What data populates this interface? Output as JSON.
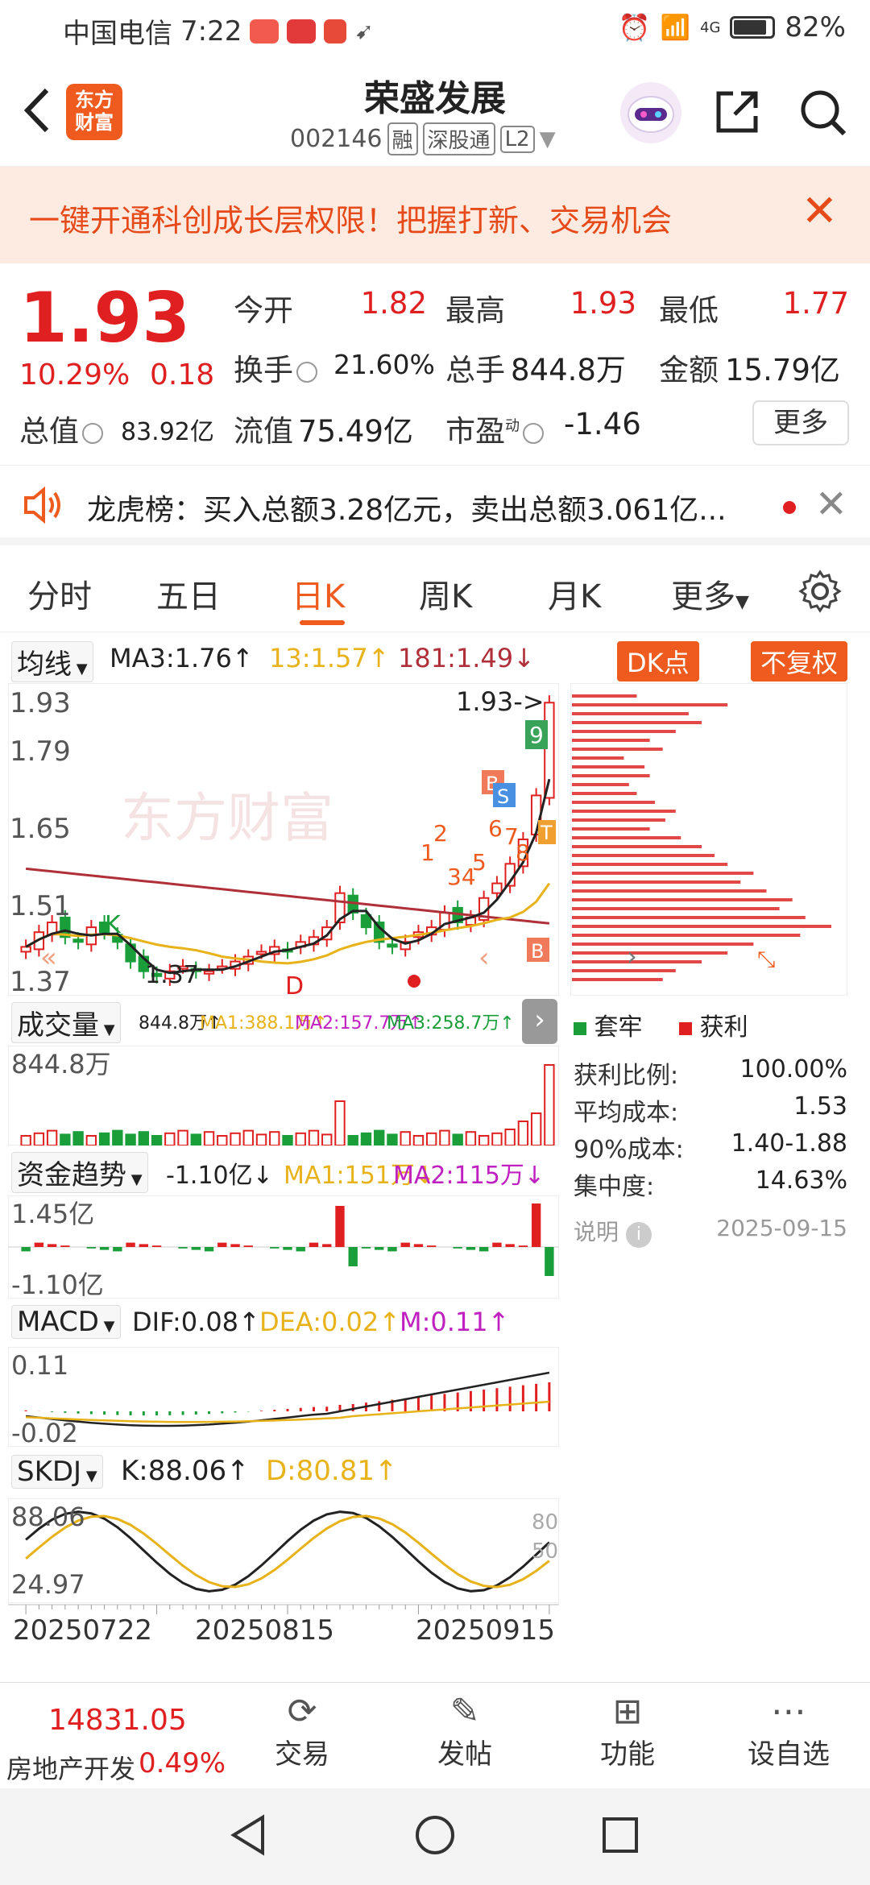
{
  "status_bar": {
    "carrier": "中国电信",
    "time": "7:22",
    "network": "4G",
    "battery": "82%"
  },
  "header": {
    "back_icon": "chevron-left-icon",
    "logo_text_1": "东方",
    "logo_text_2": "财富",
    "title": "荣盛发展",
    "code": "002146",
    "tags": [
      "融",
      "深股通",
      "L2"
    ]
  },
  "banner": {
    "text": "一键开通科创成长层权限！把握打新、交易机会"
  },
  "quote": {
    "price": "1.93",
    "change_pct": "10.29%",
    "change": "0.18",
    "open_label": "今开",
    "open": "1.82",
    "high_label": "最高",
    "high": "1.93",
    "low_label": "最低",
    "low": "1.77",
    "turnover_label": "换手",
    "turnover": "21.60%",
    "volume_label": "总手",
    "volume": "844.8万",
    "amount_label": "金额",
    "amount": "15.79亿",
    "mktcap_label": "总值",
    "mktcap": "83.92亿",
    "float_label": "流值",
    "float": "75.49亿",
    "pe_label": "市盈",
    "pe_sup": "动",
    "pe": "-1.46",
    "more": "更多"
  },
  "lhb": {
    "text": "龙虎榜：买入总额3.28亿元，卖出总额3.061亿..."
  },
  "tabs": [
    "分时",
    "五日",
    "日K",
    "周K",
    "月K",
    "更多"
  ],
  "active_tab": "日K",
  "kline": {
    "ma_selector": "均线",
    "ma3": "MA3:1.76↑",
    "ma13": "13:1.57↑",
    "ma181": "181:1.49↓",
    "dk_button": "DK点",
    "fq_button": "不复权",
    "y_labels": [
      "1.93",
      "1.79",
      "1.65",
      "1.51",
      "1.37"
    ],
    "last_marker": "1.93->",
    "low_marker": "1.37",
    "signals": [
      "K",
      "D",
      "B",
      "S",
      "1",
      "2",
      "34",
      "5",
      "6",
      "7",
      "8",
      "9",
      "T"
    ],
    "watermark": "东方财富",
    "closes": [
      1.43,
      1.46,
      1.48,
      1.45,
      1.44,
      1.47,
      1.46,
      1.44,
      1.4,
      1.38,
      1.37,
      1.38,
      1.39,
      1.38,
      1.38,
      1.39,
      1.4,
      1.41,
      1.42,
      1.43,
      1.42,
      1.44,
      1.45,
      1.47,
      1.54,
      1.5,
      1.47,
      1.44,
      1.43,
      1.44,
      1.46,
      1.47,
      1.5,
      1.48,
      1.49,
      1.53,
      1.56,
      1.6,
      1.65,
      1.74,
      1.93
    ]
  },
  "volume": {
    "selector": "成交量",
    "vol": "844.8万↑",
    "ma1": "MA1:388.1万↑",
    "ma2": "MA2:157.7万↑",
    "ma3": "MA3:258.7万↑",
    "y_max": "844.8万"
  },
  "fund": {
    "selector": "资金趋势",
    "val": "-1.10亿↓",
    "ma1": "MA1:151万↓",
    "ma2": "MA2:115万↓",
    "y_top": "1.45亿",
    "y_bottom": "-1.10亿"
  },
  "macd": {
    "selector": "MACD",
    "dif": "DIF:0.08↑",
    "dea": "DEA:0.02↑",
    "m": "M:0.11↑",
    "y_top": "0.11",
    "y_bottom": "-0.02"
  },
  "skdj": {
    "selector": "SKDJ",
    "k": "K:88.06↑",
    "d": "D:80.81↑",
    "y_top": "88.06",
    "y_bottom": "24.97",
    "r80": "80",
    "r50": "50"
  },
  "x_dates": [
    "20250722",
    "20250815",
    "20250915"
  ],
  "chips": {
    "legend_trap": "套牢",
    "legend_profit": "获利",
    "rows": [
      {
        "label": "获利比例:",
        "value": "100.00%"
      },
      {
        "label": "平均成本:",
        "value": "1.53"
      },
      {
        "label": "90%成本:",
        "value": "1.40-1.88"
      },
      {
        "label": "集中度:",
        "value": "14.63%"
      }
    ],
    "note_label": "说明",
    "date": "2025-09-15"
  },
  "bottom_nav": {
    "index_value": "14831.05",
    "index_name": "房地产开发",
    "index_pct": "0.49%",
    "items": [
      "交易",
      "发帖",
      "功能",
      "设自选"
    ]
  },
  "colors": {
    "up": "#e02020",
    "down": "#1a9e3a",
    "accent": "#ef5a1e",
    "ma13": "#e8b21a",
    "ma181": "#b0303a"
  }
}
